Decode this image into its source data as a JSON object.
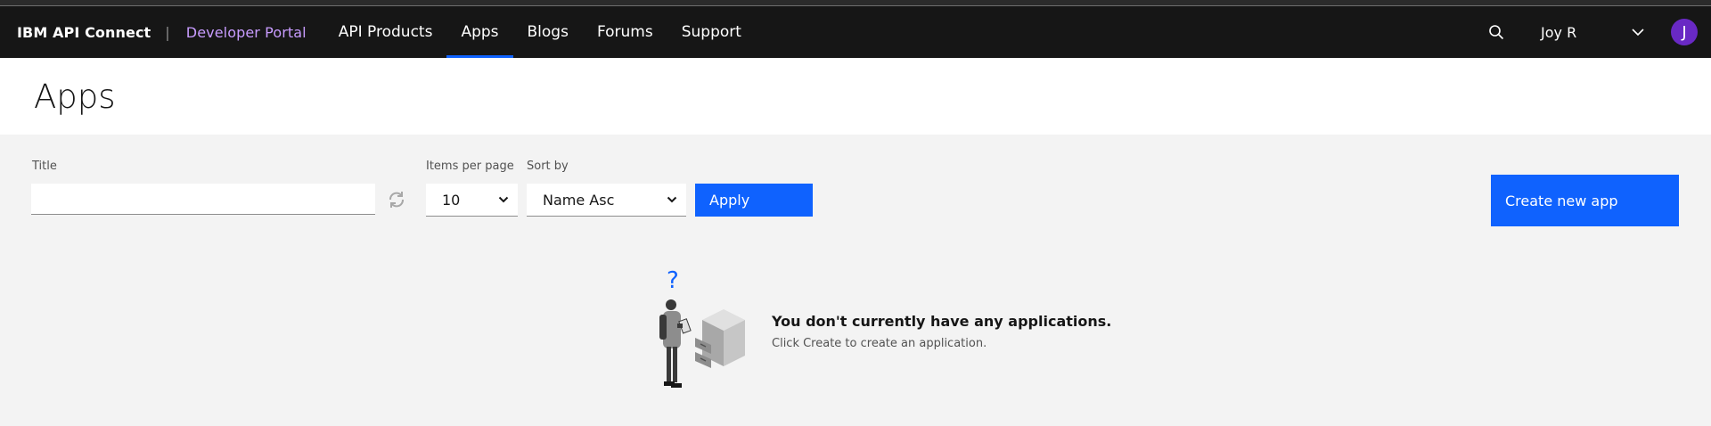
{
  "nav": {
    "brand_product": "IBM API Connect",
    "brand_separator": "|",
    "brand_portal": "Developer Portal",
    "links": [
      "API Products",
      "Apps",
      "Blogs",
      "Forums",
      "Support"
    ],
    "active_link": "Apps",
    "user_name": "Joy R",
    "avatar_initial": "J",
    "icons": {
      "search": "search-icon",
      "menu": "chevron-down-icon"
    }
  },
  "page": {
    "title": "Apps"
  },
  "filters": {
    "title_label": "Title",
    "title_value": "",
    "refresh_icon": "refresh-icon",
    "items_per_page_label": "Items per page",
    "items_per_page_value": "10",
    "sort_by_label": "Sort by",
    "sort_by_value": "Name Asc",
    "apply_label": "Apply"
  },
  "actions": {
    "create_label": "Create new app"
  },
  "empty_state": {
    "heading": "You don't currently have any applications.",
    "message": "Click Create to create an application.",
    "illustration_mark": "?"
  },
  "colors": {
    "accent": "#0f62fe",
    "navbar": "#161616",
    "portal_text": "#c89cff",
    "avatar": "#6929c4"
  }
}
